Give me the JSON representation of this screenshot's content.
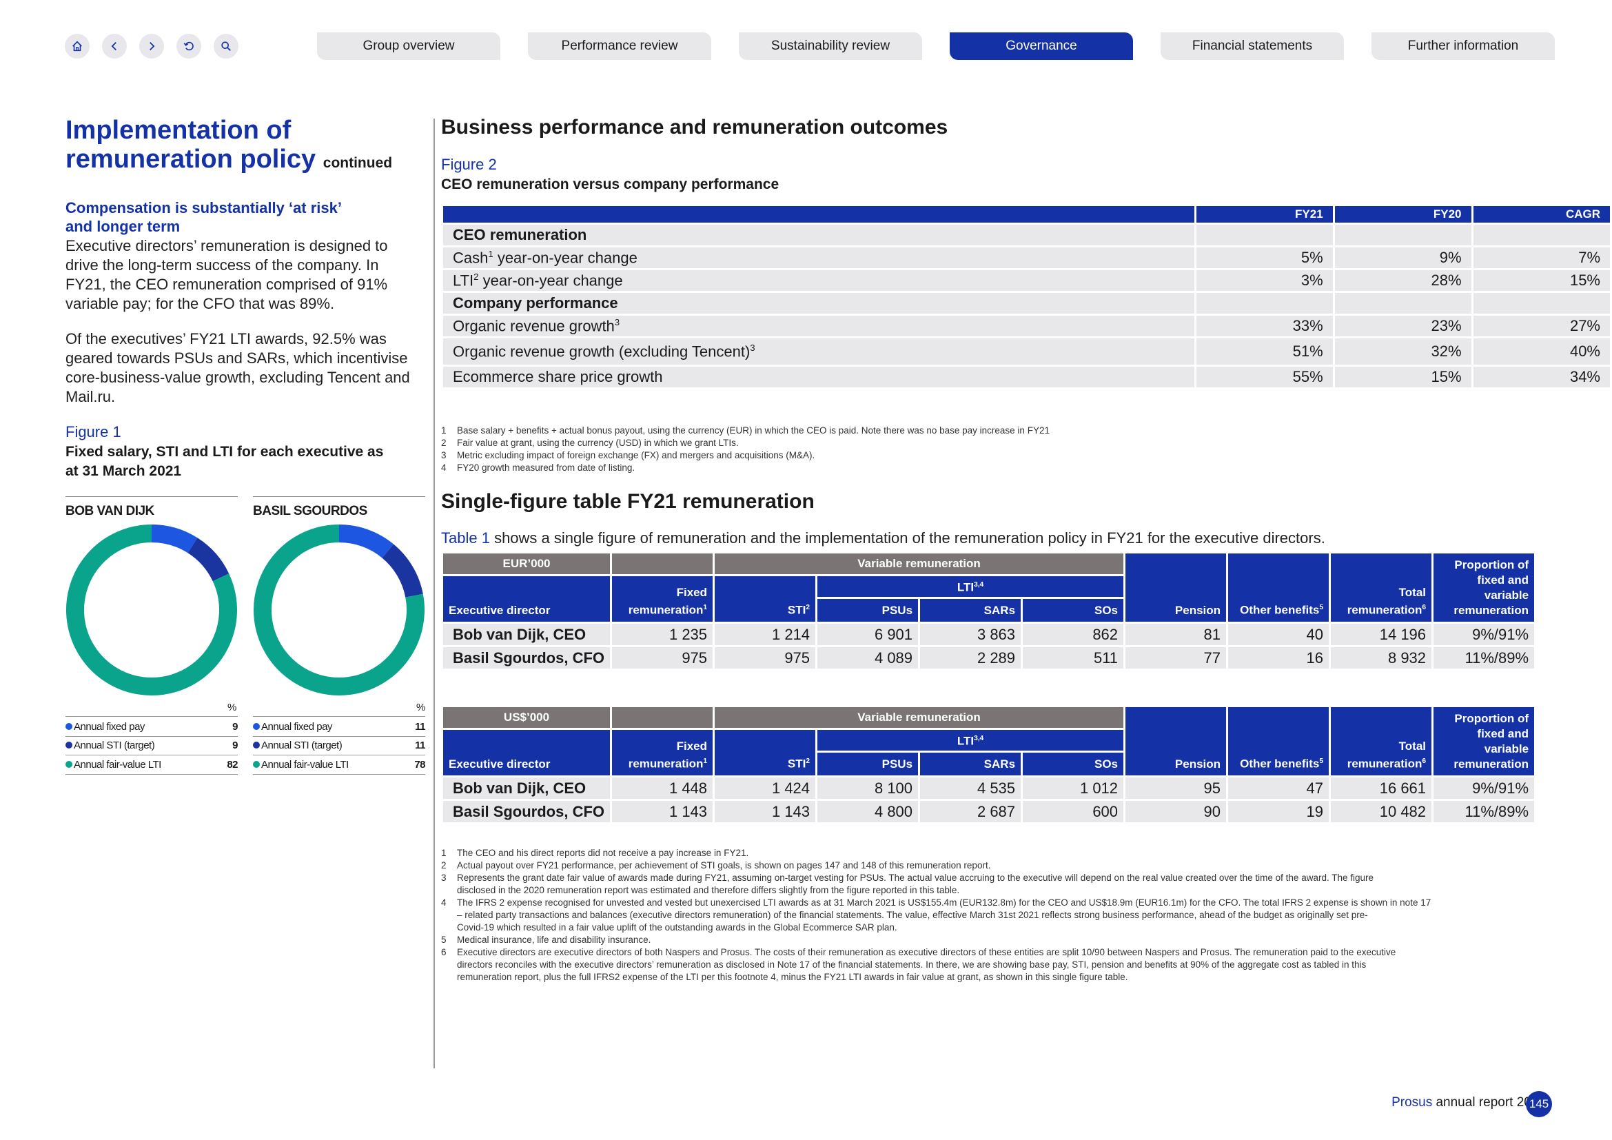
{
  "nav": {
    "tabs": [
      "Group overview",
      "Performance review",
      "Sustainability review",
      "Governance",
      "Financial statements",
      "Further information"
    ],
    "active_tab": "Governance"
  },
  "left": {
    "title_line1": "Implementation of",
    "title_line2": "remuneration policy",
    "title_suffix": "continued",
    "subhead_line1": "Compensation is substantially ‘at risk’",
    "subhead_line2": "and longer term",
    "para1_lines": [
      "Executive directors’ remuneration is designed to",
      "drive the long-term success of the company. In",
      "FY21, the CEO remuneration comprised of 91%",
      "variable pay; for the CFO that was 89%."
    ],
    "para2_lines": [
      "Of the executives’ FY21 LTI awards, 92.5% was",
      "geared towards PSUs and SARs, which incentivise",
      "core-business-value growth, excluding Tencent and",
      "Mail.ru."
    ],
    "fig_label": "Figure 1",
    "fig_title_line1": "Fixed salary, STI and LTI for each executive as",
    "fig_title_line2": "at 31 March 2021",
    "pct_label": "%",
    "colors": {
      "fixed": "#1d56e0",
      "sti": "#1a34a0",
      "lti": "#0aa38c"
    },
    "execs": [
      {
        "name": "BOB VAN DIJK",
        "legend": [
          {
            "label": "Annual fixed pay",
            "value": "9"
          },
          {
            "label": "Annual STI (target)",
            "value": "9"
          },
          {
            "label": "Annual fair-value LTI",
            "value": "82"
          }
        ]
      },
      {
        "name": "BASIL SGOURDOS",
        "legend": [
          {
            "label": "Annual fixed pay",
            "value": "11"
          },
          {
            "label": "Annual STI (target)",
            "value": "11"
          },
          {
            "label": "Annual fair-value LTI",
            "value": "78"
          }
        ]
      }
    ]
  },
  "right": {
    "section1_title": "Business performance and remuneration outcomes",
    "fig2_label": "Figure 2",
    "fig2_title": "CEO remuneration versus company performance",
    "fig2_headers": [
      "FY21",
      "FY20",
      "CAGR"
    ],
    "fig2_rows": [
      {
        "label": "CEO remuneration",
        "sup": "",
        "label_after": "",
        "section": true,
        "values": [
          "",
          "",
          ""
        ]
      },
      {
        "label": "Cash",
        "sup": "1",
        "label_after": " year-on-year change",
        "section": false,
        "values": [
          "5%",
          "9%",
          "7%"
        ]
      },
      {
        "label": "LTI",
        "sup": "2",
        "label_after": " year-on-year change",
        "section": false,
        "values": [
          "3%",
          "28%",
          "15%"
        ]
      },
      {
        "label": "Company performance",
        "sup": "",
        "label_after": "",
        "section": true,
        "values": [
          "",
          "",
          ""
        ]
      },
      {
        "label": "Organic revenue growth",
        "sup": "3",
        "label_after": "",
        "section": false,
        "values": [
          "33%",
          "23%",
          "27%"
        ]
      },
      {
        "label": "Organic revenue growth (excluding Tencent)",
        "sup": "3",
        "label_after": "",
        "section": false,
        "values": [
          "51%",
          "32%",
          "40%"
        ]
      },
      {
        "label": "Ecommerce share price growth",
        "sup": "",
        "label_after": "",
        "section": false,
        "values": [
          "55%",
          "15%",
          "34%"
        ]
      }
    ],
    "fig2_footnotes": [
      {
        "n": "1",
        "text": "Base salary + benefits + actual bonus payout, using the currency (EUR) in which the CEO is paid. Note there was no base pay increase in FY21"
      },
      {
        "n": "2",
        "text": "Fair value at grant, using the currency (USD) in which we grant LTIs."
      },
      {
        "n": "3",
        "text": "Metric excluding impact of foreign exchange (FX) and mergers and acquisitions (M&A)."
      },
      {
        "n": "4",
        "text": "FY20 growth measured from date of listing."
      }
    ],
    "section2_title": "Single-figure table FY21 remuneration",
    "intro_link": "Table 1",
    "intro_rest": " shows a single figure of remuneration and the implementation of the remuneration policy in FY21 for the executive directors.",
    "sf_headers": {
      "variable": "Variable remuneration",
      "lti": "LTI",
      "lti_sup": "3,4",
      "exec": "Executive director",
      "fixed_l1": "Fixed",
      "fixed_l2": "remuneration",
      "fixed_sup": "1",
      "sti": "STI",
      "sti_sup": "2",
      "psus": "PSUs",
      "sars": "SARs",
      "sos": "SOs",
      "pension": "Pension",
      "other": "Other benefits",
      "other_sup": "5",
      "total_l1": "Total",
      "total_l2": "remuneration",
      "total_sup": "6",
      "prop_l1": "Proportion of",
      "prop_l2": "fixed and",
      "prop_l3": "variable",
      "prop_l4": "remuneration"
    },
    "eur_table": {
      "currency": "EUR’000",
      "rows": [
        {
          "name": "Bob van Dijk, CEO",
          "values": [
            "1 235",
            "1 214",
            "6 901",
            "3 863",
            "862",
            "81",
            "40",
            "14 196",
            "9%/91%"
          ]
        },
        {
          "name": "Basil Sgourdos, CFO",
          "values": [
            "975",
            "975",
            "4 089",
            "2 289",
            "511",
            "77",
            "16",
            "8 932",
            "11%/89%"
          ]
        }
      ]
    },
    "usd_table": {
      "currency": "US$’000",
      "rows": [
        {
          "name": "Bob van Dijk, CEO",
          "values": [
            "1 448",
            "1 424",
            "8 100",
            "4 535",
            "1 012",
            "95",
            "47",
            "16 661",
            "9%/91%"
          ]
        },
        {
          "name": "Basil Sgourdos, CFO",
          "values": [
            "1 143",
            "1 143",
            "4 800",
            "2 687",
            "600",
            "90",
            "19",
            "10 482",
            "11%/89%"
          ]
        }
      ]
    },
    "sf_footnotes": [
      {
        "n": "1",
        "lines": [
          "The CEO and his direct reports did not receive a pay increase in FY21."
        ]
      },
      {
        "n": "2",
        "lines": [
          "Actual payout over FY21 performance, per achievement of STI goals, is shown on pages 147 and 148 of this remuneration report."
        ]
      },
      {
        "n": "3",
        "lines": [
          "Represents the grant date fair value of awards made during FY21, assuming on-target vesting for PSUs. The actual value accruing to the executive will depend on the real value created over the time of the award. The figure",
          "disclosed in the 2020 remuneration report was estimated and therefore differs slightly from the figure reported in this table."
        ]
      },
      {
        "n": "4",
        "lines": [
          "The IFRS 2 expense recognised for unvested and vested but unexercised LTI awards as at 31 March 2021 is US$155.4m (EUR132.8m) for the CEO and US$18.9m (EUR16.1m) for the CFO. The total IFRS 2 expense is shown in note 17",
          "– related party transactions and balances (executive directors remuneration) of the financial statements. The value, effective March 31st 2021 reflects strong business performance, ahead of the budget as originally set pre-",
          "Covid-19 which resulted in a fair value uplift of the outstanding awards in the Global Ecommerce SAR plan."
        ]
      },
      {
        "n": "5",
        "lines": [
          "Medical insurance, life and disability insurance."
        ]
      },
      {
        "n": "6",
        "lines": [
          "Executive directors are executive directors of both Naspers and Prosus. The costs of their remuneration as executive directors of these entities are split 10/90 between Naspers and Prosus. The remuneration paid to the executive",
          "directors reconciles with the executive directors’ remuneration as disclosed in Note 17 of the financial statements. In there, we are showing base pay, STI, pension and benefits at 90% of the aggregate cost as tabled in this",
          "remuneration report, plus the full IFRS2 expense of the LTI per this footnote 4, minus the FY21 LTI awards in fair value at grant, as shown in this single figure table."
        ]
      }
    ]
  },
  "footer": {
    "brand": "Prosus",
    "text": " annual report 2021",
    "page": "145"
  }
}
